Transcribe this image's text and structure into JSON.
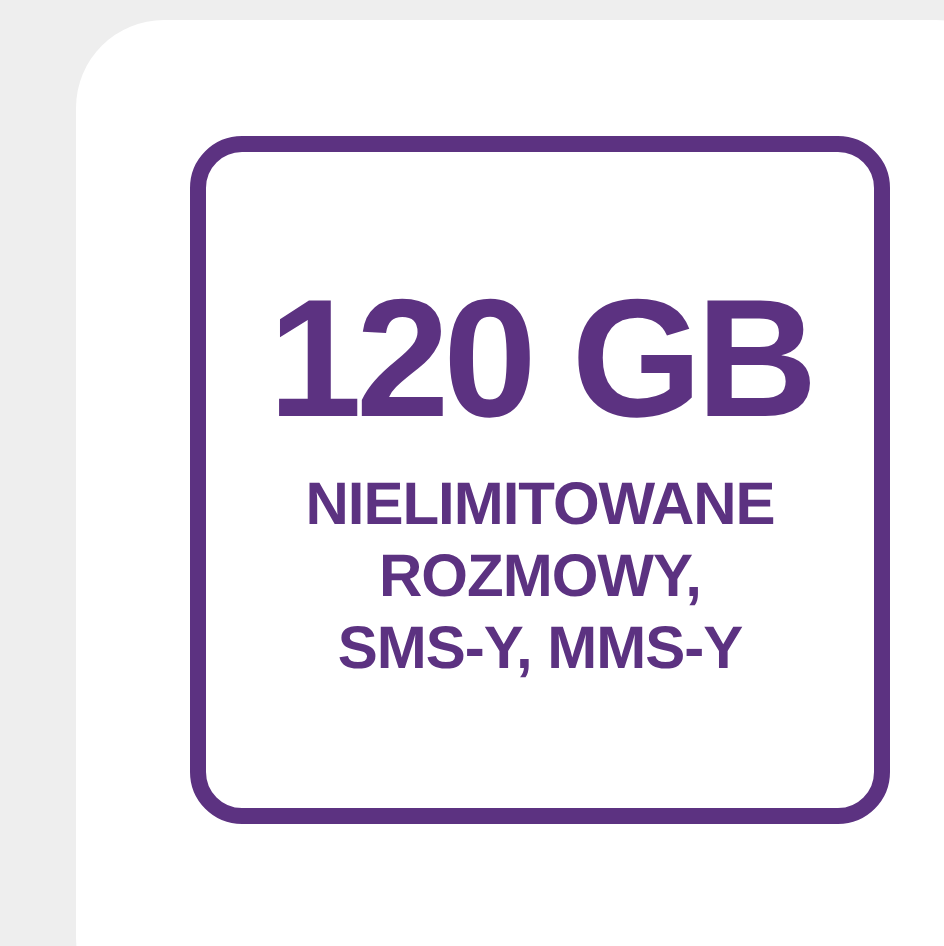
{
  "badge": {
    "headline": "120 GB",
    "lines": [
      "NIELIMITOWANE",
      "ROZMOWY,",
      "SMS-Y, MMS-Y"
    ]
  }
}
